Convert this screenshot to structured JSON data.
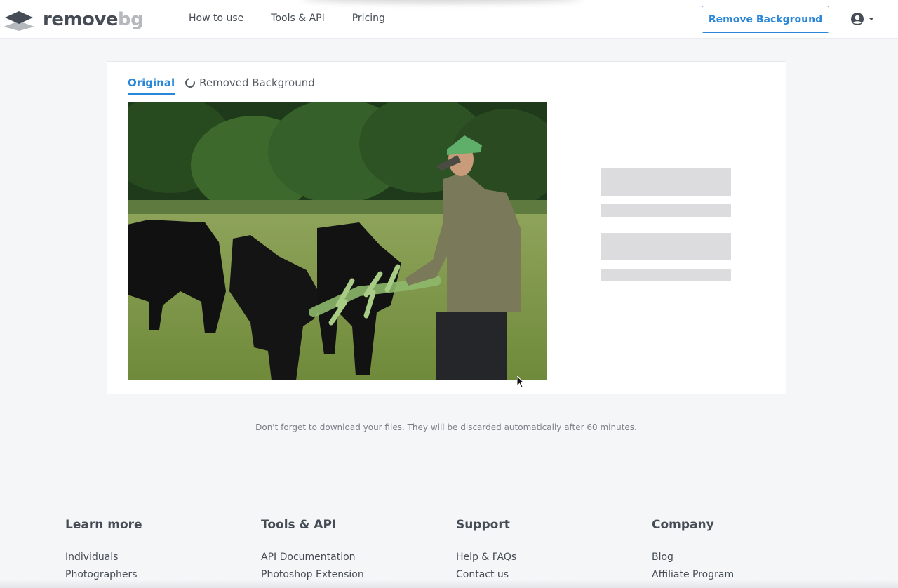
{
  "header": {
    "logo": {
      "word_main": "remove",
      "word_accent": "bg",
      "icon": "layers-icon"
    },
    "nav": [
      "How to use",
      "Tools & API",
      "Pricing"
    ],
    "cta_label": "Remove Background",
    "user_icon": "user-circle-icon"
  },
  "editor": {
    "tabs": [
      {
        "label": "Original",
        "active": true
      },
      {
        "label": "Removed Background",
        "active": false,
        "state": "loading",
        "icon": "spinner-icon"
      }
    ],
    "image_alt": "Man feeding a leafy branch to black cows in a green pasture",
    "side_panel": "loading-skeleton"
  },
  "notice": "Don't forget to download your files. They will be discarded automatically after 60 minutes.",
  "footer": {
    "columns": [
      {
        "title": "Learn more",
        "links": [
          "Individuals",
          "Photographers"
        ]
      },
      {
        "title": "Tools & API",
        "links": [
          "API Documentation",
          "Photoshop Extension"
        ]
      },
      {
        "title": "Support",
        "links": [
          "Help & FAQs",
          "Contact us"
        ]
      },
      {
        "title": "Company",
        "links": [
          "Blog",
          "Affiliate Program"
        ]
      }
    ]
  },
  "colors": {
    "accent": "#2a86d8",
    "text": "#454c55",
    "background": "#f5f6f8",
    "skeleton": "#dcdcde"
  }
}
